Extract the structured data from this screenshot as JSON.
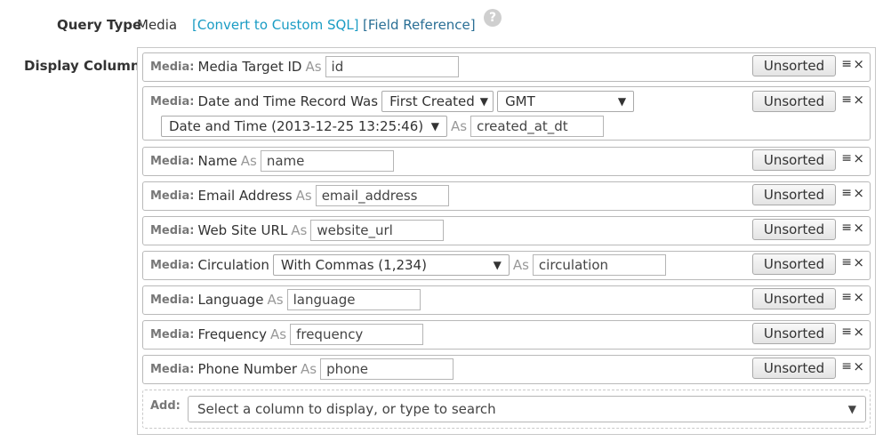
{
  "query_type": {
    "label": "Query Type",
    "value": "Media",
    "convert_link": "[Convert to Custom SQL]",
    "reference_link": "[Field Reference]",
    "help_icon": "?"
  },
  "display_columns": {
    "label": "Display Columns",
    "source_label": "Media:",
    "as_label": "As",
    "sort_label": "Unsorted",
    "drag_handle": "≡",
    "remove_glyph": "×",
    "rows": [
      {
        "field": "Media Target ID",
        "alias": "id"
      },
      {
        "field": "Date and Time Record Was",
        "option1": "First Created",
        "option2": "GMT",
        "option3": "Date and Time (2013-12-25 13:25:46)",
        "alias": "created_at_dt"
      },
      {
        "field": "Name",
        "alias": "name"
      },
      {
        "field": "Email Address",
        "alias": "email_address"
      },
      {
        "field": "Web Site URL",
        "alias": "website_url"
      },
      {
        "field": "Circulation",
        "option1": "With Commas (1,234)",
        "alias": "circulation"
      },
      {
        "field": "Language",
        "alias": "language"
      },
      {
        "field": "Frequency",
        "alias": "frequency"
      },
      {
        "field": "Phone Number",
        "alias": "phone"
      }
    ],
    "add_label": "Add:",
    "add_placeholder": "Select a column to display, or type to search",
    "dropdown_arrow": "▼"
  }
}
